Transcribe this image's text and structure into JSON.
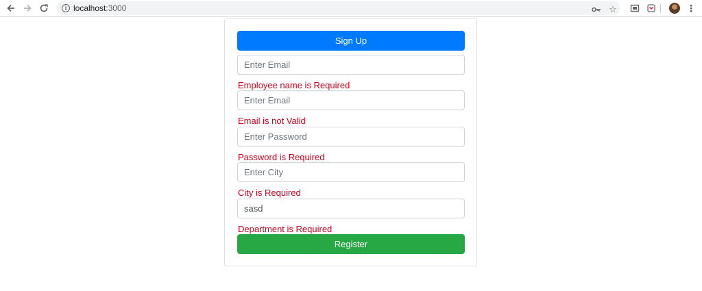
{
  "browser": {
    "url_host": "localhost",
    "url_port": ":3000",
    "back_icon": "arrow-left-icon",
    "forward_icon": "arrow-right-icon",
    "reload_icon": "reload-icon"
  },
  "form": {
    "signup_label": "Sign Up",
    "fields": [
      {
        "placeholder": "Enter Email",
        "value": "",
        "error": "Employee name is Required"
      },
      {
        "placeholder": "Enter Email",
        "value": "",
        "error": "Email is not Valid"
      },
      {
        "placeholder": "Enter Password",
        "value": "",
        "error": "Password is Required"
      },
      {
        "placeholder": "Enter City",
        "value": "",
        "error": "City is Required"
      },
      {
        "placeholder": "",
        "value": "sasd",
        "error": "Department is Required"
      }
    ],
    "register_label": "Register"
  },
  "colors": {
    "primary": "#007bff",
    "success": "#28a745",
    "error": "#d0021b"
  }
}
